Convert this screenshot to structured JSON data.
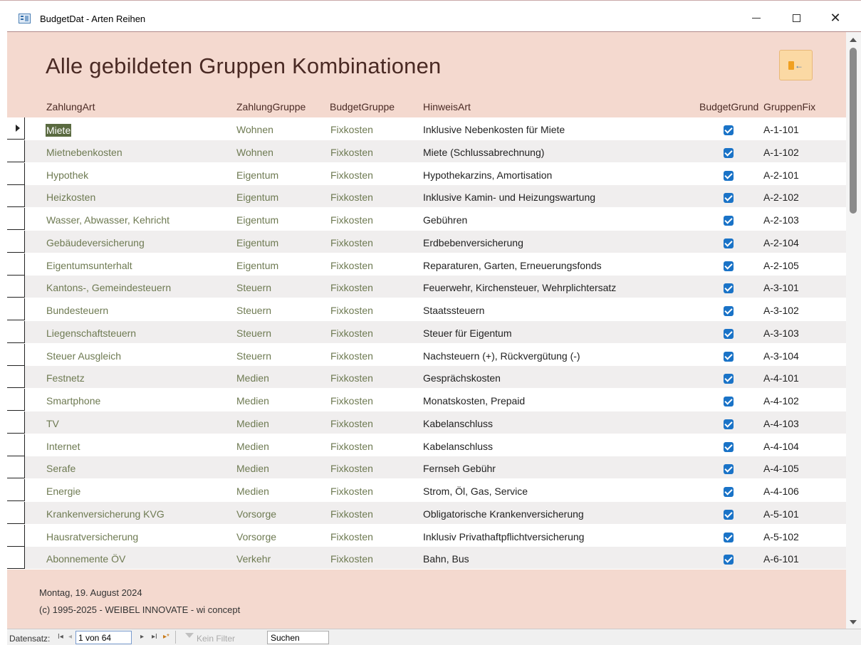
{
  "window": {
    "title": "BudgetDat - Arten Reihen",
    "minimize": "—",
    "maximize": "☐",
    "close": "✕"
  },
  "header": {
    "title": "Alle gebildeten Gruppen Kombinationen",
    "exit_icon": "exit-door-icon"
  },
  "columns": {
    "zahlungart": "ZahlungArt",
    "zahlunggruppe": "ZahlungGruppe",
    "budgetgruppe": "BudgetGruppe",
    "hinweisart": "HinweisArt",
    "budgetgrund": "BudgetGrund",
    "gruppenfix": "GruppenFix"
  },
  "rows": [
    {
      "art": "Miete",
      "zg": "Wohnen",
      "bg": "Fixkosten",
      "hw": "Inklusive Nebenkosten für Miete",
      "grund": true,
      "fix": "A-1-101"
    },
    {
      "art": "Mietnebenkosten",
      "zg": "Wohnen",
      "bg": "Fixkosten",
      "hw": "Miete (Schlussabrechnung)",
      "grund": true,
      "fix": "A-1-102"
    },
    {
      "art": "Hypothek",
      "zg": "Eigentum",
      "bg": "Fixkosten",
      "hw": "Hypothekarzins, Amortisation",
      "grund": true,
      "fix": "A-2-101"
    },
    {
      "art": "Heizkosten",
      "zg": "Eigentum",
      "bg": "Fixkosten",
      "hw": "Inklusive Kamin- und Heizungswartung",
      "grund": true,
      "fix": "A-2-102"
    },
    {
      "art": "Wasser, Abwasser, Kehricht",
      "zg": "Eigentum",
      "bg": "Fixkosten",
      "hw": "Gebühren",
      "grund": true,
      "fix": "A-2-103"
    },
    {
      "art": "Gebäudeversicherung",
      "zg": "Eigentum",
      "bg": "Fixkosten",
      "hw": "Erdbebenversicherung",
      "grund": true,
      "fix": "A-2-104"
    },
    {
      "art": "Eigentumsunterhalt",
      "zg": "Eigentum",
      "bg": "Fixkosten",
      "hw": "Reparaturen, Garten, Erneuerungsfonds",
      "grund": true,
      "fix": "A-2-105"
    },
    {
      "art": "Kantons-, Gemeindesteuern",
      "zg": "Steuern",
      "bg": "Fixkosten",
      "hw": "Feuerwehr, Kirchensteuer, Wehrplichtersatz",
      "grund": true,
      "fix": "A-3-101"
    },
    {
      "art": "Bundesteuern",
      "zg": "Steuern",
      "bg": "Fixkosten",
      "hw": "Staatssteuern",
      "grund": true,
      "fix": "A-3-102"
    },
    {
      "art": "Liegenschaftsteuern",
      "zg": "Steuern",
      "bg": "Fixkosten",
      "hw": "Steuer für Eigentum",
      "grund": true,
      "fix": "A-3-103"
    },
    {
      "art": "Steuer Ausgleich",
      "zg": "Steuern",
      "bg": "Fixkosten",
      "hw": "Nachsteuern (+), Rückvergütung (-)",
      "grund": true,
      "fix": "A-3-104"
    },
    {
      "art": "Festnetz",
      "zg": "Medien",
      "bg": "Fixkosten",
      "hw": "Gesprächskosten",
      "grund": true,
      "fix": "A-4-101"
    },
    {
      "art": "Smartphone",
      "zg": "Medien",
      "bg": "Fixkosten",
      "hw": "Monatskosten, Prepaid",
      "grund": true,
      "fix": "A-4-102"
    },
    {
      "art": "TV",
      "zg": "Medien",
      "bg": "Fixkosten",
      "hw": "Kabelanschluss",
      "grund": true,
      "fix": "A-4-103"
    },
    {
      "art": "Internet",
      "zg": "Medien",
      "bg": "Fixkosten",
      "hw": "Kabelanschluss",
      "grund": true,
      "fix": "A-4-104"
    },
    {
      "art": "Serafe",
      "zg": "Medien",
      "bg": "Fixkosten",
      "hw": "Fernseh Gebühr",
      "grund": true,
      "fix": "A-4-105"
    },
    {
      "art": "Energie",
      "zg": "Medien",
      "bg": "Fixkosten",
      "hw": "Strom, Öl, Gas, Service",
      "grund": true,
      "fix": "A-4-106"
    },
    {
      "art": "Krankenversicherung KVG",
      "zg": "Vorsorge",
      "bg": "Fixkosten",
      "hw": "Obligatorische Krankenversicherung",
      "grund": true,
      "fix": "A-5-101"
    },
    {
      "art": "Hausratversicherung",
      "zg": "Vorsorge",
      "bg": "Fixkosten",
      "hw": "Inklusiv Privathaftpflichtversicherung",
      "grund": true,
      "fix": "A-5-102"
    },
    {
      "art": "Abonnemente ÖV",
      "zg": "Verkehr",
      "bg": "Fixkosten",
      "hw": "Bahn, Bus",
      "grund": true,
      "fix": "A-6-101"
    }
  ],
  "footer": {
    "date": "Montag, 19. August 2024",
    "copyright": "(c) 1995-2025 - WEIBEL INNOVATE - wi concept"
  },
  "navigation": {
    "label": "Datensatz:",
    "first": "I◂",
    "prev": "◂",
    "record": "1 von 64",
    "next": "▸",
    "last": "▸I",
    "new": "▸*",
    "filter_label": "Kein Filter",
    "search": "Suchen"
  },
  "colors": {
    "section_bg": "#f4d9cf",
    "title_color": "#4a2a24",
    "checkbox_blue": "#1a73c7",
    "text_green": "#6e7a52"
  }
}
